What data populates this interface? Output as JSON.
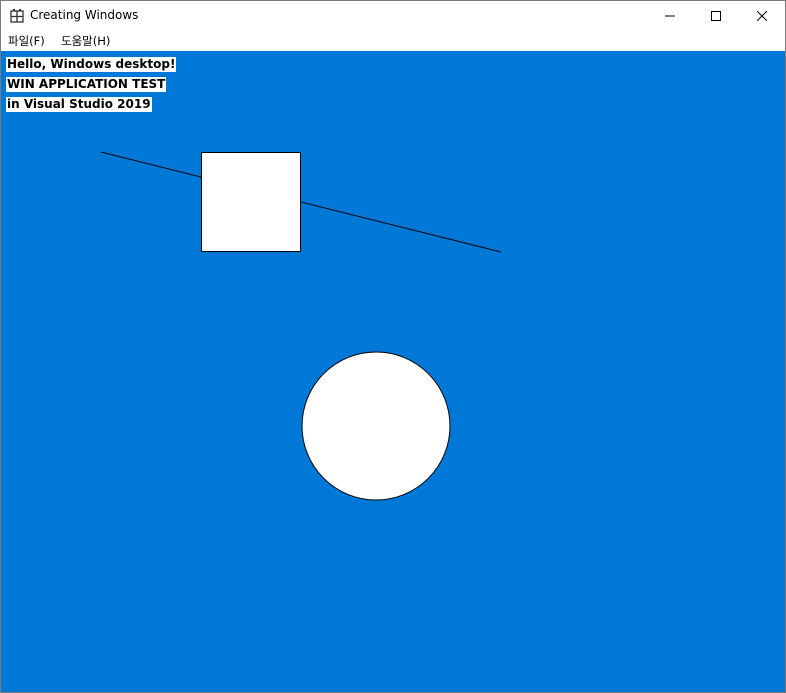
{
  "window": {
    "title": "Creating Windows",
    "icon": "app-grid-icon",
    "controls": {
      "minimize": "minimize-icon",
      "maximize": "maximize-icon",
      "close": "close-icon"
    }
  },
  "menu": {
    "file_label": "파일(F)",
    "help_label": "도움말(H)"
  },
  "client": {
    "background": "#0078d7",
    "lines": [
      "Hello, Windows desktop!",
      "WIN APPLICATION TEST",
      "in Visual Studio 2019"
    ]
  }
}
